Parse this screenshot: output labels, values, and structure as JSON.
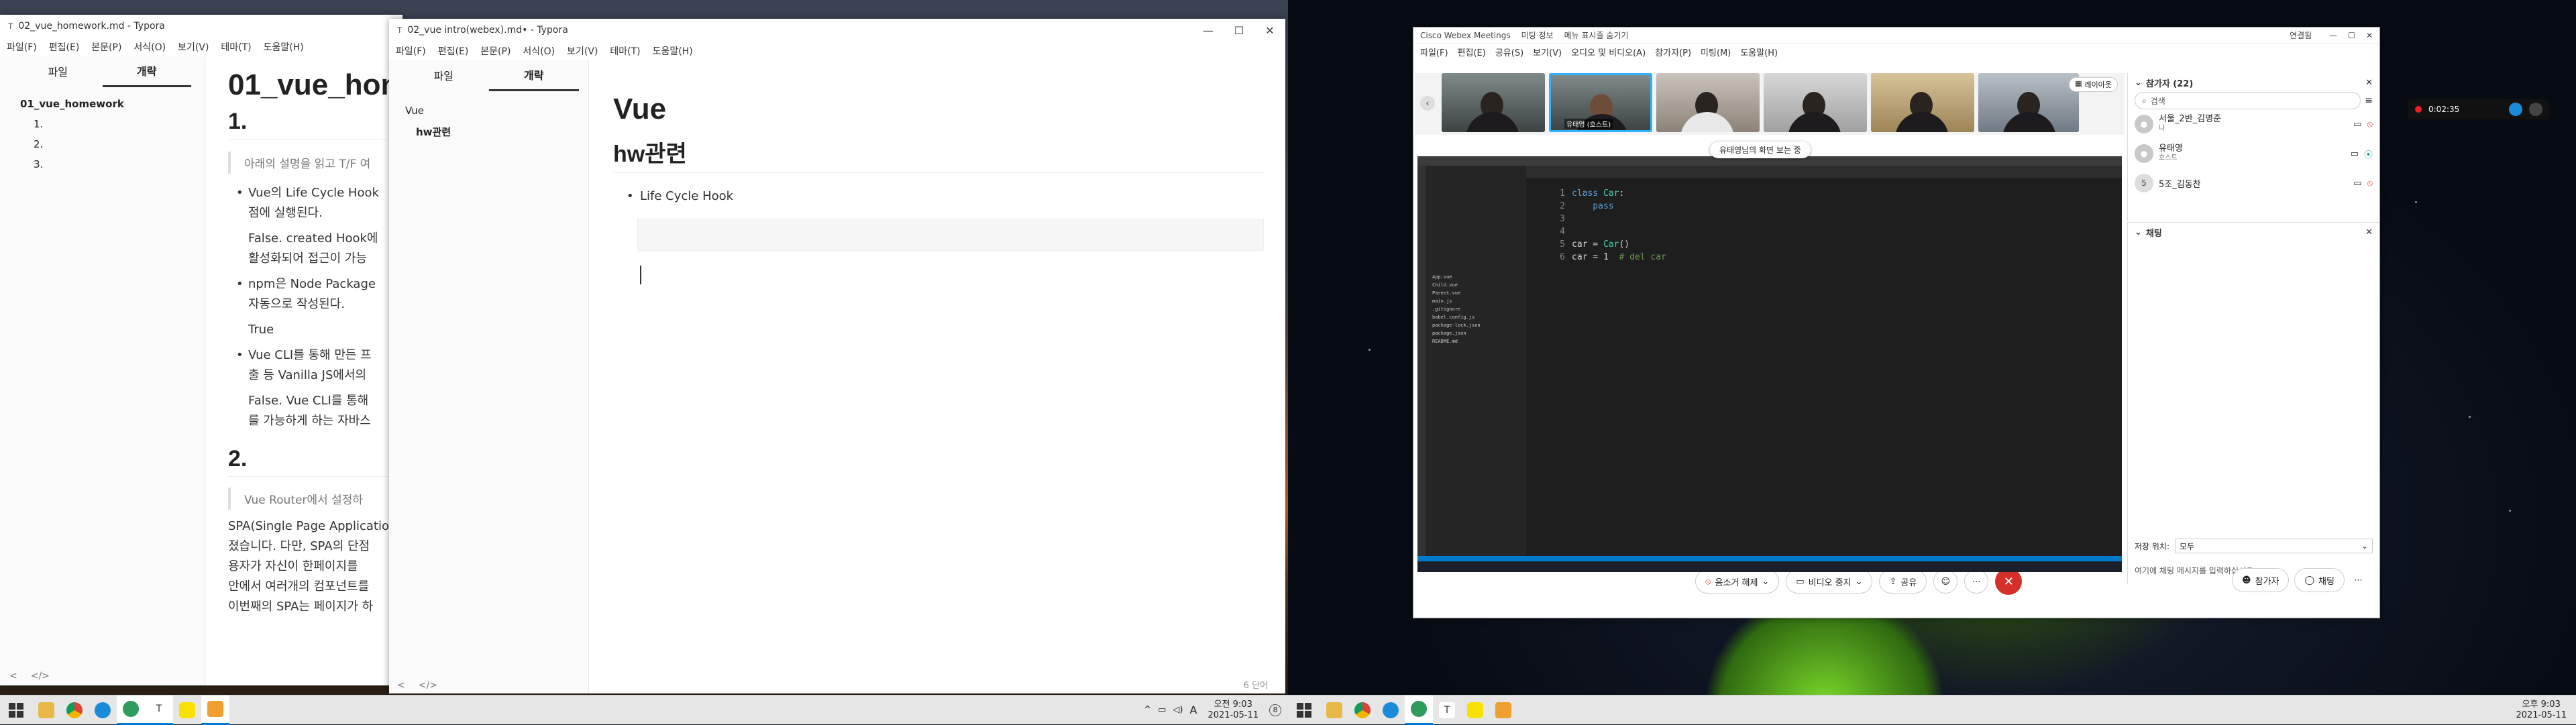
{
  "typora_back": {
    "title": "02_vue_homework.md - Typora",
    "menu": [
      "파일(F)",
      "편집(E)",
      "본문(P)",
      "서식(O)",
      "보기(V)",
      "테마(T)",
      "도움말(H)"
    ],
    "tabs": [
      "파일",
      "개략"
    ],
    "outline": [
      "01_vue_homework",
      "1.",
      "2.",
      "3."
    ],
    "h1": "01_vue_hom",
    "h2_1": "1.",
    "blockquote1": "아래의 설명을 읽고 T/F 여",
    "items": [
      {
        "line1": "Vue의 Life Cycle Hook",
        "line2": "점에 실행된다.",
        "answer1": "False. created Hook에",
        "answer2": "활성화되어 접근이 가능"
      },
      {
        "line1": "npm은 Node Package",
        "line2": "자동으로 작성된다.",
        "answer1": "True",
        "answer2": ""
      },
      {
        "line1": "Vue CLI를 통해 만든 프",
        "line2": "출 등 Vanilla JS에서의",
        "answer1": "False. Vue CLI를 통해",
        "answer2": "를 가능하게 하는 자바스"
      }
    ],
    "h2_2": "2.",
    "blockquote2": "Vue Router에서 설정하",
    "para": [
      "SPA(Single Page Applicatio",
      "졌습니다. 다만, SPA의 단점",
      "용자가 자신이 한페이지를",
      "안에서 여러개의 컴포넌트를",
      "이번째의 SPA는 페이지가 하"
    ],
    "footer_icons": [
      "<",
      "</>"
    ]
  },
  "typora_front": {
    "title": "02_vue intro(webex).md• - Typora",
    "menu": [
      "파일(F)",
      "편집(E)",
      "본문(P)",
      "서식(O)",
      "보기(V)",
      "테마(T)",
      "도움말(H)"
    ],
    "tabs": [
      "파일",
      "개략"
    ],
    "outline": [
      "Vue",
      "hw관련"
    ],
    "h1": "Vue",
    "h2": "hw관련",
    "bullet": "Life Cycle Hook",
    "word_count": "6 단어",
    "window_buttons": [
      "—",
      "☐",
      "✕"
    ]
  },
  "taskbar_left": {
    "time": "오전 9:03",
    "date": "2021-05-11",
    "ime": "A",
    "notif": "8"
  },
  "webex": {
    "title": "Cisco Webex Meetings",
    "meeting_info": "미팅 정보",
    "hide_menu": "메뉴 표시줄 숨기기",
    "connected": "연결됨",
    "menu": [
      "파일(F)",
      "편집(E)",
      "공유(S)",
      "보기(V)",
      "오디오 및 비디오(A)",
      "참가자(P)",
      "미팅(M)",
      "도움말(H)"
    ],
    "layout_btn": "레이아웃",
    "host_label": "유태영 (호스트)",
    "share_banner": "유태영님의 화면 보는 중",
    "participants_title": "참가자 (22)",
    "search_placeholder": "검색",
    "participants": [
      {
        "name": "서울_2반_김명준",
        "role": "나"
      },
      {
        "name": "유태영",
        "role": "호스트"
      },
      {
        "name": "5조_김동찬",
        "role": ""
      }
    ],
    "chat_title": "채팅",
    "chat_to_label": "저장 위치:",
    "chat_to_value": "모두",
    "chat_placeholder": "여기에 채팅 메시지를 입력하십시오.",
    "controls": {
      "mute": "음소거 해제",
      "video": "비디오 중지",
      "share": "공유",
      "participants": "참가자",
      "chat": "채팅"
    }
  },
  "vscode": {
    "code": [
      {
        "n": "1",
        "text": "class Car:"
      },
      {
        "n": "2",
        "text": "    pass"
      },
      {
        "n": "3",
        "text": ""
      },
      {
        "n": "4",
        "text": ""
      },
      {
        "n": "5",
        "text": "car = Car()"
      },
      {
        "n": "6",
        "text": "car = 1  # del car"
      }
    ],
    "files": [
      "App.vue",
      "Child.vue",
      "Parent.vue",
      "main.js",
      ".gitignore",
      "babel.config.js",
      "package-lock.json",
      "package.json",
      "README.md"
    ]
  },
  "recording": {
    "time": "0:02:35"
  },
  "taskbar_right": {
    "time": "오후 9:03",
    "date": "2021-05-11"
  }
}
